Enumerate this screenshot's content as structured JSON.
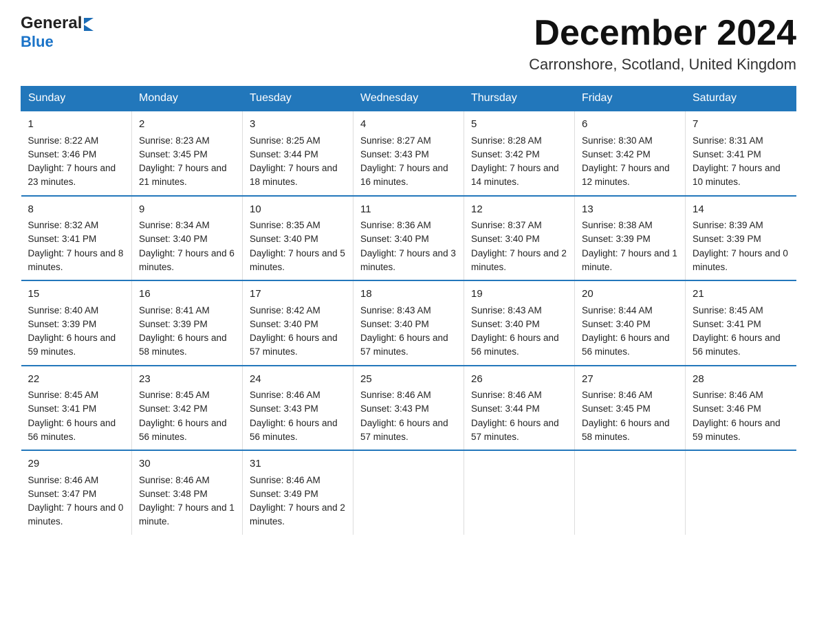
{
  "header": {
    "logo_general": "General",
    "logo_blue": "Blue",
    "month": "December 2024",
    "location": "Carronshore, Scotland, United Kingdom"
  },
  "days_of_week": [
    "Sunday",
    "Monday",
    "Tuesday",
    "Wednesday",
    "Thursday",
    "Friday",
    "Saturday"
  ],
  "weeks": [
    [
      {
        "date": "1",
        "sunrise": "Sunrise: 8:22 AM",
        "sunset": "Sunset: 3:46 PM",
        "daylight": "Daylight: 7 hours and 23 minutes."
      },
      {
        "date": "2",
        "sunrise": "Sunrise: 8:23 AM",
        "sunset": "Sunset: 3:45 PM",
        "daylight": "Daylight: 7 hours and 21 minutes."
      },
      {
        "date": "3",
        "sunrise": "Sunrise: 8:25 AM",
        "sunset": "Sunset: 3:44 PM",
        "daylight": "Daylight: 7 hours and 18 minutes."
      },
      {
        "date": "4",
        "sunrise": "Sunrise: 8:27 AM",
        "sunset": "Sunset: 3:43 PM",
        "daylight": "Daylight: 7 hours and 16 minutes."
      },
      {
        "date": "5",
        "sunrise": "Sunrise: 8:28 AM",
        "sunset": "Sunset: 3:42 PM",
        "daylight": "Daylight: 7 hours and 14 minutes."
      },
      {
        "date": "6",
        "sunrise": "Sunrise: 8:30 AM",
        "sunset": "Sunset: 3:42 PM",
        "daylight": "Daylight: 7 hours and 12 minutes."
      },
      {
        "date": "7",
        "sunrise": "Sunrise: 8:31 AM",
        "sunset": "Sunset: 3:41 PM",
        "daylight": "Daylight: 7 hours and 10 minutes."
      }
    ],
    [
      {
        "date": "8",
        "sunrise": "Sunrise: 8:32 AM",
        "sunset": "Sunset: 3:41 PM",
        "daylight": "Daylight: 7 hours and 8 minutes."
      },
      {
        "date": "9",
        "sunrise": "Sunrise: 8:34 AM",
        "sunset": "Sunset: 3:40 PM",
        "daylight": "Daylight: 7 hours and 6 minutes."
      },
      {
        "date": "10",
        "sunrise": "Sunrise: 8:35 AM",
        "sunset": "Sunset: 3:40 PM",
        "daylight": "Daylight: 7 hours and 5 minutes."
      },
      {
        "date": "11",
        "sunrise": "Sunrise: 8:36 AM",
        "sunset": "Sunset: 3:40 PM",
        "daylight": "Daylight: 7 hours and 3 minutes."
      },
      {
        "date": "12",
        "sunrise": "Sunrise: 8:37 AM",
        "sunset": "Sunset: 3:40 PM",
        "daylight": "Daylight: 7 hours and 2 minutes."
      },
      {
        "date": "13",
        "sunrise": "Sunrise: 8:38 AM",
        "sunset": "Sunset: 3:39 PM",
        "daylight": "Daylight: 7 hours and 1 minute."
      },
      {
        "date": "14",
        "sunrise": "Sunrise: 8:39 AM",
        "sunset": "Sunset: 3:39 PM",
        "daylight": "Daylight: 7 hours and 0 minutes."
      }
    ],
    [
      {
        "date": "15",
        "sunrise": "Sunrise: 8:40 AM",
        "sunset": "Sunset: 3:39 PM",
        "daylight": "Daylight: 6 hours and 59 minutes."
      },
      {
        "date": "16",
        "sunrise": "Sunrise: 8:41 AM",
        "sunset": "Sunset: 3:39 PM",
        "daylight": "Daylight: 6 hours and 58 minutes."
      },
      {
        "date": "17",
        "sunrise": "Sunrise: 8:42 AM",
        "sunset": "Sunset: 3:40 PM",
        "daylight": "Daylight: 6 hours and 57 minutes."
      },
      {
        "date": "18",
        "sunrise": "Sunrise: 8:43 AM",
        "sunset": "Sunset: 3:40 PM",
        "daylight": "Daylight: 6 hours and 57 minutes."
      },
      {
        "date": "19",
        "sunrise": "Sunrise: 8:43 AM",
        "sunset": "Sunset: 3:40 PM",
        "daylight": "Daylight: 6 hours and 56 minutes."
      },
      {
        "date": "20",
        "sunrise": "Sunrise: 8:44 AM",
        "sunset": "Sunset: 3:40 PM",
        "daylight": "Daylight: 6 hours and 56 minutes."
      },
      {
        "date": "21",
        "sunrise": "Sunrise: 8:45 AM",
        "sunset": "Sunset: 3:41 PM",
        "daylight": "Daylight: 6 hours and 56 minutes."
      }
    ],
    [
      {
        "date": "22",
        "sunrise": "Sunrise: 8:45 AM",
        "sunset": "Sunset: 3:41 PM",
        "daylight": "Daylight: 6 hours and 56 minutes."
      },
      {
        "date": "23",
        "sunrise": "Sunrise: 8:45 AM",
        "sunset": "Sunset: 3:42 PM",
        "daylight": "Daylight: 6 hours and 56 minutes."
      },
      {
        "date": "24",
        "sunrise": "Sunrise: 8:46 AM",
        "sunset": "Sunset: 3:43 PM",
        "daylight": "Daylight: 6 hours and 56 minutes."
      },
      {
        "date": "25",
        "sunrise": "Sunrise: 8:46 AM",
        "sunset": "Sunset: 3:43 PM",
        "daylight": "Daylight: 6 hours and 57 minutes."
      },
      {
        "date": "26",
        "sunrise": "Sunrise: 8:46 AM",
        "sunset": "Sunset: 3:44 PM",
        "daylight": "Daylight: 6 hours and 57 minutes."
      },
      {
        "date": "27",
        "sunrise": "Sunrise: 8:46 AM",
        "sunset": "Sunset: 3:45 PM",
        "daylight": "Daylight: 6 hours and 58 minutes."
      },
      {
        "date": "28",
        "sunrise": "Sunrise: 8:46 AM",
        "sunset": "Sunset: 3:46 PM",
        "daylight": "Daylight: 6 hours and 59 minutes."
      }
    ],
    [
      {
        "date": "29",
        "sunrise": "Sunrise: 8:46 AM",
        "sunset": "Sunset: 3:47 PM",
        "daylight": "Daylight: 7 hours and 0 minutes."
      },
      {
        "date": "30",
        "sunrise": "Sunrise: 8:46 AM",
        "sunset": "Sunset: 3:48 PM",
        "daylight": "Daylight: 7 hours and 1 minute."
      },
      {
        "date": "31",
        "sunrise": "Sunrise: 8:46 AM",
        "sunset": "Sunset: 3:49 PM",
        "daylight": "Daylight: 7 hours and 2 minutes."
      },
      {
        "date": "",
        "sunrise": "",
        "sunset": "",
        "daylight": ""
      },
      {
        "date": "",
        "sunrise": "",
        "sunset": "",
        "daylight": ""
      },
      {
        "date": "",
        "sunrise": "",
        "sunset": "",
        "daylight": ""
      },
      {
        "date": "",
        "sunrise": "",
        "sunset": "",
        "daylight": ""
      }
    ]
  ]
}
